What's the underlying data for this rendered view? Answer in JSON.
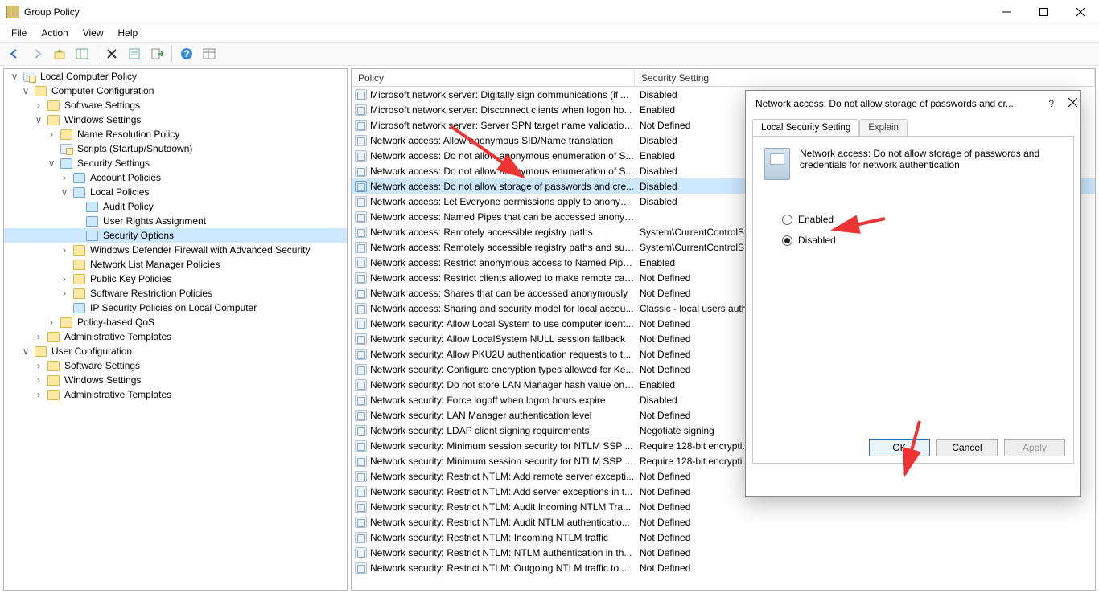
{
  "window": {
    "title": "Group Policy"
  },
  "menu": {
    "file": "File",
    "action": "Action",
    "view": "View",
    "help": "Help"
  },
  "tree": {
    "root": "Local Computer Policy",
    "cc": "Computer Configuration",
    "ss": "Software Settings",
    "ws": "Windows Settings",
    "nrp": "Name Resolution Policy",
    "scripts": "Scripts (Startup/Shutdown)",
    "sec": "Security Settings",
    "ap": "Account Policies",
    "lp": "Local Policies",
    "audit": "Audit Policy",
    "ura": "User Rights Assignment",
    "so": "Security Options",
    "wdf": "Windows Defender Firewall with Advanced Security",
    "nlmp": "Network List Manager Policies",
    "pkp": "Public Key Policies",
    "srp": "Software Restriction Policies",
    "ipsec": "IP Security Policies on Local Computer",
    "pbqos": "Policy-based QoS",
    "at": "Administrative Templates",
    "uc": "User Configuration",
    "uss": "Software Settings",
    "uws": "Windows Settings",
    "uat": "Administrative Templates"
  },
  "columns": {
    "policy": "Policy",
    "setting": "Security Setting"
  },
  "policies": [
    {
      "p": "Microsoft network server: Digitally sign communications (if ...",
      "s": "Disabled"
    },
    {
      "p": "Microsoft network server: Disconnect clients when logon ho...",
      "s": "Enabled"
    },
    {
      "p": "Microsoft network server: Server SPN target name validation...",
      "s": "Not Defined"
    },
    {
      "p": "Network access: Allow anonymous SID/Name translation",
      "s": "Disabled"
    },
    {
      "p": "Network access: Do not allow anonymous enumeration of S...",
      "s": "Enabled"
    },
    {
      "p": "Network access: Do not allow anonymous enumeration of S...",
      "s": "Disabled"
    },
    {
      "p": "Network access: Do not allow storage of passwords and cre...",
      "s": "Disabled",
      "sel": true
    },
    {
      "p": "Network access: Let Everyone permissions apply to anonym...",
      "s": "Disabled"
    },
    {
      "p": "Network access: Named Pipes that can be accessed anonym...",
      "s": ""
    },
    {
      "p": "Network access: Remotely accessible registry paths",
      "s": "System\\CurrentControlS..."
    },
    {
      "p": "Network access: Remotely accessible registry paths and sub...",
      "s": "System\\CurrentControlS..."
    },
    {
      "p": "Network access: Restrict anonymous access to Named Pipes...",
      "s": "Enabled"
    },
    {
      "p": "Network access: Restrict clients allowed to make remote call...",
      "s": "Not Defined"
    },
    {
      "p": "Network access: Shares that can be accessed anonymously",
      "s": "Not Defined"
    },
    {
      "p": "Network access: Sharing and security model for local accou...",
      "s": "Classic - local users auth..."
    },
    {
      "p": "Network security: Allow Local System to use computer ident...",
      "s": "Not Defined"
    },
    {
      "p": "Network security: Allow LocalSystem NULL session fallback",
      "s": "Not Defined"
    },
    {
      "p": "Network security: Allow PKU2U authentication requests to t...",
      "s": "Not Defined"
    },
    {
      "p": "Network security: Configure encryption types allowed for Ke...",
      "s": "Not Defined"
    },
    {
      "p": "Network security: Do not store LAN Manager hash value on ...",
      "s": "Enabled"
    },
    {
      "p": "Network security: Force logoff when logon hours expire",
      "s": "Disabled"
    },
    {
      "p": "Network security: LAN Manager authentication level",
      "s": "Not Defined"
    },
    {
      "p": "Network security: LDAP client signing requirements",
      "s": "Negotiate signing"
    },
    {
      "p": "Network security: Minimum session security for NTLM SSP ...",
      "s": "Require 128-bit encrypti..."
    },
    {
      "p": "Network security: Minimum session security for NTLM SSP ...",
      "s": "Require 128-bit encrypti..."
    },
    {
      "p": "Network security: Restrict NTLM: Add remote server excepti...",
      "s": "Not Defined"
    },
    {
      "p": "Network security: Restrict NTLM: Add server exceptions in t...",
      "s": "Not Defined"
    },
    {
      "p": "Network security: Restrict NTLM: Audit Incoming NTLM Tra...",
      "s": "Not Defined"
    },
    {
      "p": "Network security: Restrict NTLM: Audit NTLM authenticatio...",
      "s": "Not Defined"
    },
    {
      "p": "Network security: Restrict NTLM: Incoming NTLM traffic",
      "s": "Not Defined"
    },
    {
      "p": "Network security: Restrict NTLM: NTLM authentication in th...",
      "s": "Not Defined"
    },
    {
      "p": "Network security: Restrict NTLM: Outgoing NTLM traffic to ...",
      "s": "Not Defined"
    }
  ],
  "dialog": {
    "title": "Network access: Do not allow storage of passwords and cr...",
    "tab1": "Local Security Setting",
    "tab2": "Explain",
    "desc": "Network access: Do not allow storage of passwords and credentials for network authentication",
    "enabled": "Enabled",
    "disabled": "Disabled",
    "ok": "OK",
    "cancel": "Cancel",
    "apply": "Apply",
    "help": "?"
  }
}
